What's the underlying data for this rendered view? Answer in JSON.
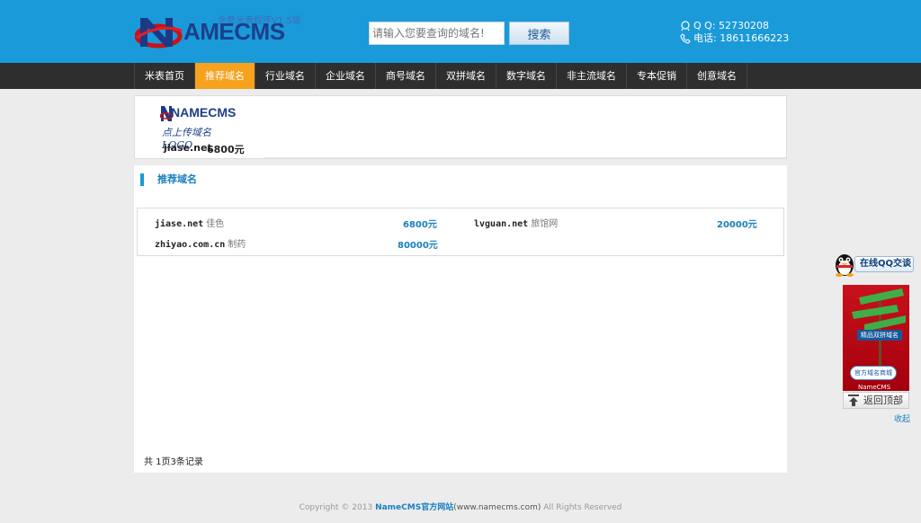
{
  "header": {
    "logo_text_a": "N",
    "logo_text_b": "AME",
    "logo_text_c": "CMS",
    "logo_tagline": "免费米表程序V1.5版",
    "search_placeholder": "请输入您要查询的域名!",
    "search_button": "搜索",
    "qq": "Q Q: 52730208",
    "phone": "电话: 18611666223"
  },
  "nav": {
    "items": [
      "米表首页",
      "推荐域名",
      "行业域名",
      "企业域名",
      "商号域名",
      "双拼域名",
      "数字域名",
      "非主流域名",
      "专本促销",
      "创意域名"
    ],
    "active_index": 1
  },
  "banner": {
    "logo_title": "NAMECMS",
    "logo_subtitle": "点上传域名LOGO",
    "domain": "jiase.net",
    "price": "6800元"
  },
  "section": {
    "title": "推荐域名"
  },
  "domains": [
    {
      "name": "jiase.net",
      "category": "佳色",
      "price": "6800元"
    },
    {
      "name": "lvguan.net",
      "category": "旅馆网",
      "price": "20000元"
    },
    {
      "name": "zhiyao.com.cn",
      "category": "制药",
      "price": "80000元"
    }
  ],
  "pagination": {
    "records": "共 1页3条记录"
  },
  "footer": {
    "copyright": "Copyright © 2013",
    "site": "NameCMS官方网站",
    "url": "(www.namecms.com)",
    "rights": "All Rights Reserved"
  },
  "float": {
    "qq_chat": "在线QQ交谈",
    "ad_label1": "精品双拼域名",
    "ad_label2": "官方域名商城",
    "ad_label3": "NameCMS",
    "back_top": "返回顶部",
    "collapse": "收起"
  },
  "colors": {
    "header_bg": "#1a9ad9",
    "nav_bg": "#2e2e2e",
    "nav_active": "#f6a21c",
    "price": "#1a7fc0"
  }
}
